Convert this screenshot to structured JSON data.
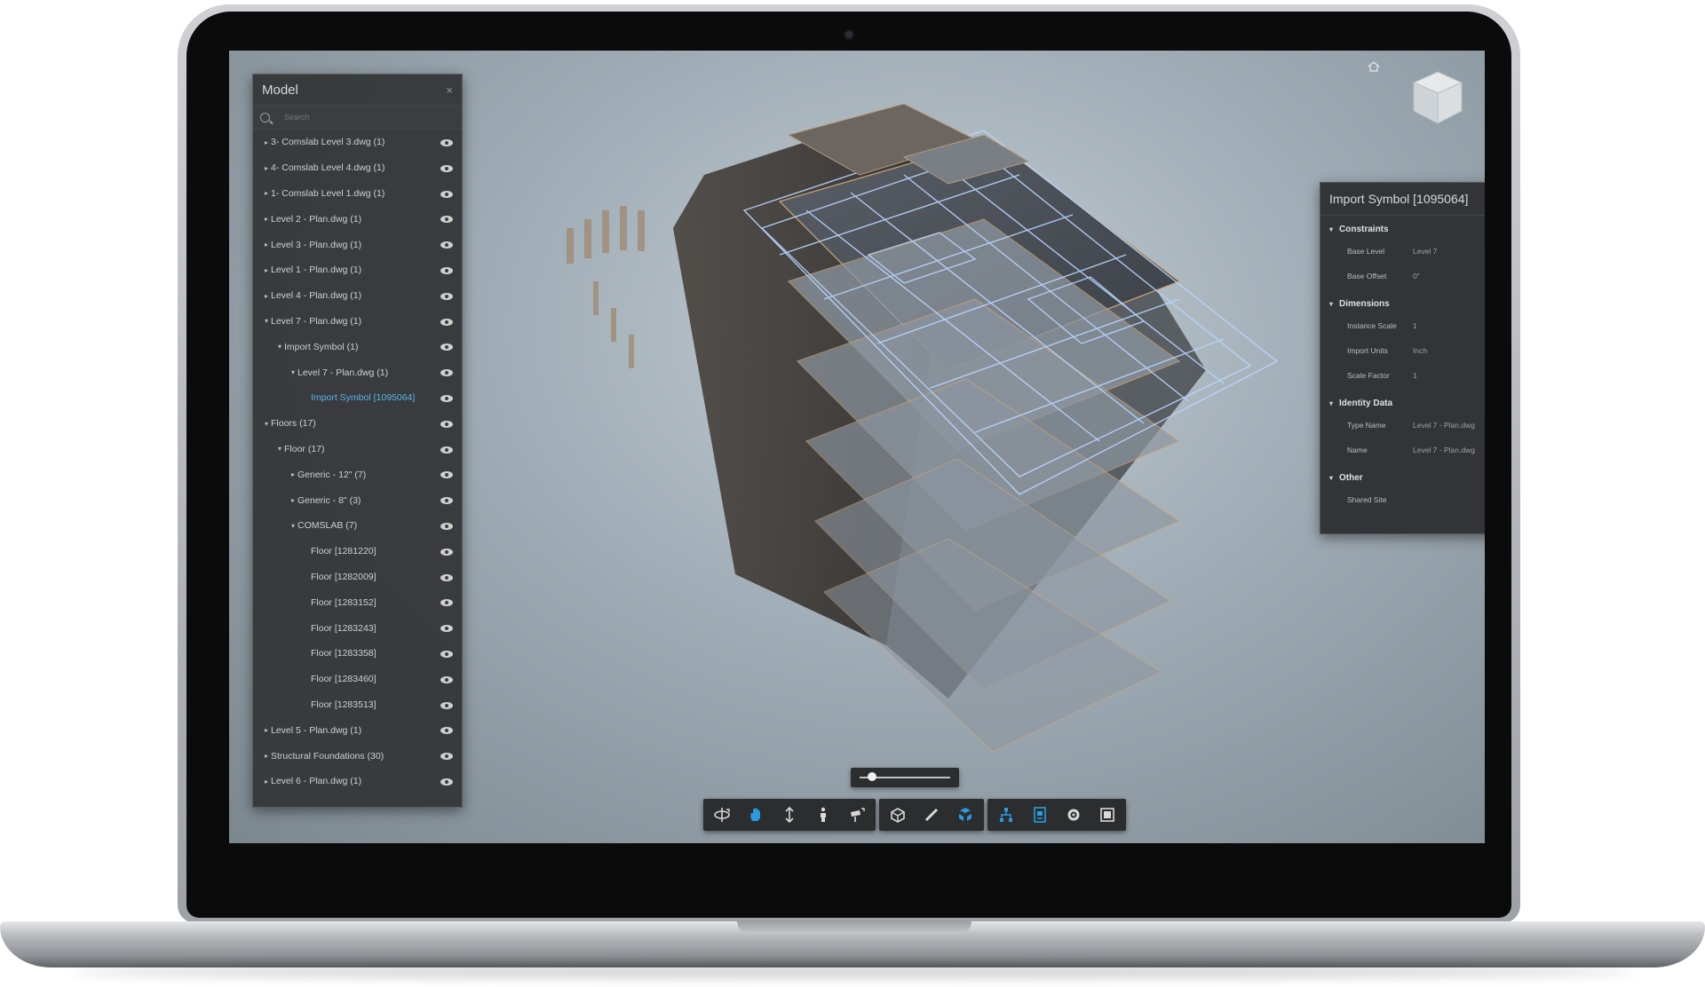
{
  "model_panel": {
    "title": "Model",
    "close_label": "×",
    "search": {
      "placeholder": "Search",
      "value": ""
    },
    "items": [
      {
        "label": "3- Comslab Level 3.dwg (1)",
        "indent": 0,
        "caret": "▸"
      },
      {
        "label": "4- Comslab Level 4.dwg (1)",
        "indent": 0,
        "caret": "▸"
      },
      {
        "label": "1- Comslab Level 1.dwg (1)",
        "indent": 0,
        "caret": "▸"
      },
      {
        "label": "Level 2 - Plan.dwg (1)",
        "indent": 0,
        "caret": "▸"
      },
      {
        "label": "Level 3 - Plan.dwg (1)",
        "indent": 0,
        "caret": "▸"
      },
      {
        "label": "Level 1 - Plan.dwg (1)",
        "indent": 0,
        "caret": "▸"
      },
      {
        "label": "Level 4 - Plan.dwg (1)",
        "indent": 0,
        "caret": "▸"
      },
      {
        "label": "Level 7 - Plan.dwg (1)",
        "indent": 0,
        "caret": "▾"
      },
      {
        "label": "Import Symbol (1)",
        "indent": 1,
        "caret": "▾"
      },
      {
        "label": "Level 7 - Plan.dwg (1)",
        "indent": 2,
        "caret": "▾"
      },
      {
        "label": "Import Symbol [1095064]",
        "indent": 3,
        "caret": "",
        "selected": true
      },
      {
        "label": "Floors (17)",
        "indent": 0,
        "caret": "▾"
      },
      {
        "label": "Floor (17)",
        "indent": 1,
        "caret": "▾"
      },
      {
        "label": "Generic - 12\" (7)",
        "indent": 2,
        "caret": "▸"
      },
      {
        "label": "Generic - 8\" (3)",
        "indent": 2,
        "caret": "▸"
      },
      {
        "label": "COMSLAB (7)",
        "indent": 2,
        "caret": "▾"
      },
      {
        "label": "Floor [1281220]",
        "indent": 3,
        "caret": ""
      },
      {
        "label": "Floor [1282009]",
        "indent": 3,
        "caret": ""
      },
      {
        "label": "Floor [1283152]",
        "indent": 3,
        "caret": ""
      },
      {
        "label": "Floor [1283243]",
        "indent": 3,
        "caret": ""
      },
      {
        "label": "Floor [1283358]",
        "indent": 3,
        "caret": ""
      },
      {
        "label": "Floor [1283460]",
        "indent": 3,
        "caret": ""
      },
      {
        "label": "Floor [1283513]",
        "indent": 3,
        "caret": ""
      },
      {
        "label": "Level 5 - Plan.dwg (1)",
        "indent": 0,
        "caret": "▸"
      },
      {
        "label": "Structural Foundations (30)",
        "indent": 0,
        "caret": "▸"
      },
      {
        "label": "Level 6 - Plan.dwg (1)",
        "indent": 0,
        "caret": "▸"
      }
    ]
  },
  "properties_panel": {
    "title": "Import Symbol [1095064]",
    "close_label": "×",
    "sections": [
      {
        "title": "Constraints",
        "rows": [
          {
            "key": "Base Level",
            "value": "Level 7"
          },
          {
            "key": "Base Offset",
            "value": "0\""
          }
        ]
      },
      {
        "title": "Dimensions",
        "rows": [
          {
            "key": "Instance Scale",
            "value": "1"
          },
          {
            "key": "Import Units",
            "value": "Inch"
          },
          {
            "key": "Scale Factor",
            "value": "1"
          }
        ]
      },
      {
        "title": "Identity Data",
        "rows": [
          {
            "key": "Type Name",
            "value": "Level 7 - Plan.dwg"
          },
          {
            "key": "Name",
            "value": "Level 7 - Plan.dwg"
          }
        ]
      },
      {
        "title": "Other",
        "rows": [
          {
            "key": "Shared Site",
            "value": ""
          }
        ]
      }
    ]
  },
  "explode_slider": {
    "value": 0.1
  },
  "toolbar": {
    "active_color": "#2b9be0",
    "icon_color": "#d9d9d9",
    "groups": [
      [
        {
          "icon": "orbit-icon",
          "active": false
        },
        {
          "icon": "pan-icon",
          "active": true
        },
        {
          "icon": "zoom-icon",
          "active": false
        },
        {
          "icon": "first-person-icon",
          "active": false
        },
        {
          "icon": "camera-icon",
          "active": false
        }
      ],
      [
        {
          "icon": "section-icon",
          "active": false
        },
        {
          "icon": "measure-icon",
          "active": false
        },
        {
          "icon": "explode-icon",
          "active": true
        }
      ],
      [
        {
          "icon": "model-browser-icon",
          "active": true
        },
        {
          "icon": "properties-icon",
          "active": true
        },
        {
          "icon": "settings-icon",
          "active": false
        },
        {
          "icon": "fullscreen-icon",
          "active": false
        }
      ]
    ]
  }
}
